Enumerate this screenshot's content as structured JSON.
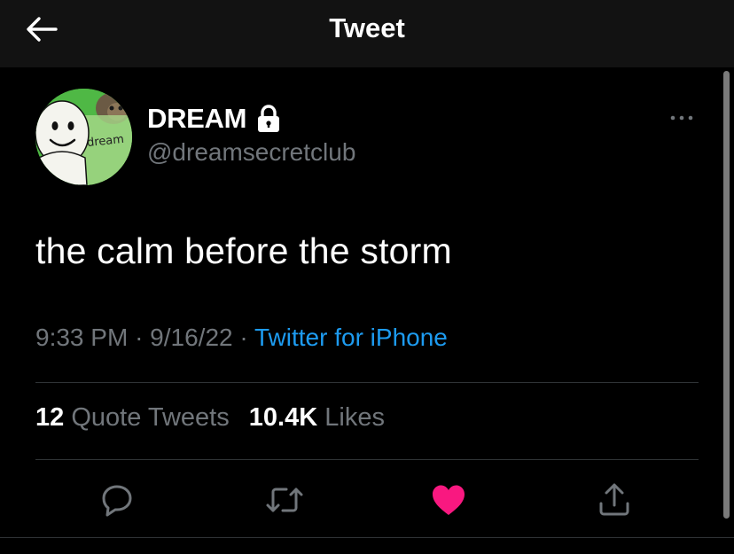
{
  "header": {
    "title": "Tweet",
    "back_icon": "arrow-left-icon"
  },
  "author": {
    "display_name": "DREAM",
    "handle": "@dreamsecretclub",
    "locked_icon": "lock-icon",
    "avatar_caption": "dream"
  },
  "tweet": {
    "text": "the calm before the storm",
    "time": "9:33 PM",
    "separator": "·",
    "date": "9/16/22",
    "source": "Twitter for iPhone"
  },
  "stats": {
    "quote_count": "12",
    "quote_label": "Quote Tweets",
    "like_count": "10.4K",
    "like_label": "Likes"
  },
  "actions": [
    {
      "name": "reply",
      "icon": "reply-icon"
    },
    {
      "name": "retweet",
      "icon": "retweet-icon"
    },
    {
      "name": "like",
      "icon": "heart-icon",
      "liked": true
    },
    {
      "name": "share",
      "icon": "share-icon"
    }
  ],
  "colors": {
    "background": "#000000",
    "topbar": "#121212",
    "text_primary": "#ffffff",
    "text_secondary": "#71767b",
    "link": "#1d9bf0",
    "like_active": "#f91880",
    "divider": "#2f3336",
    "avatar_bg": "#4fb845"
  }
}
